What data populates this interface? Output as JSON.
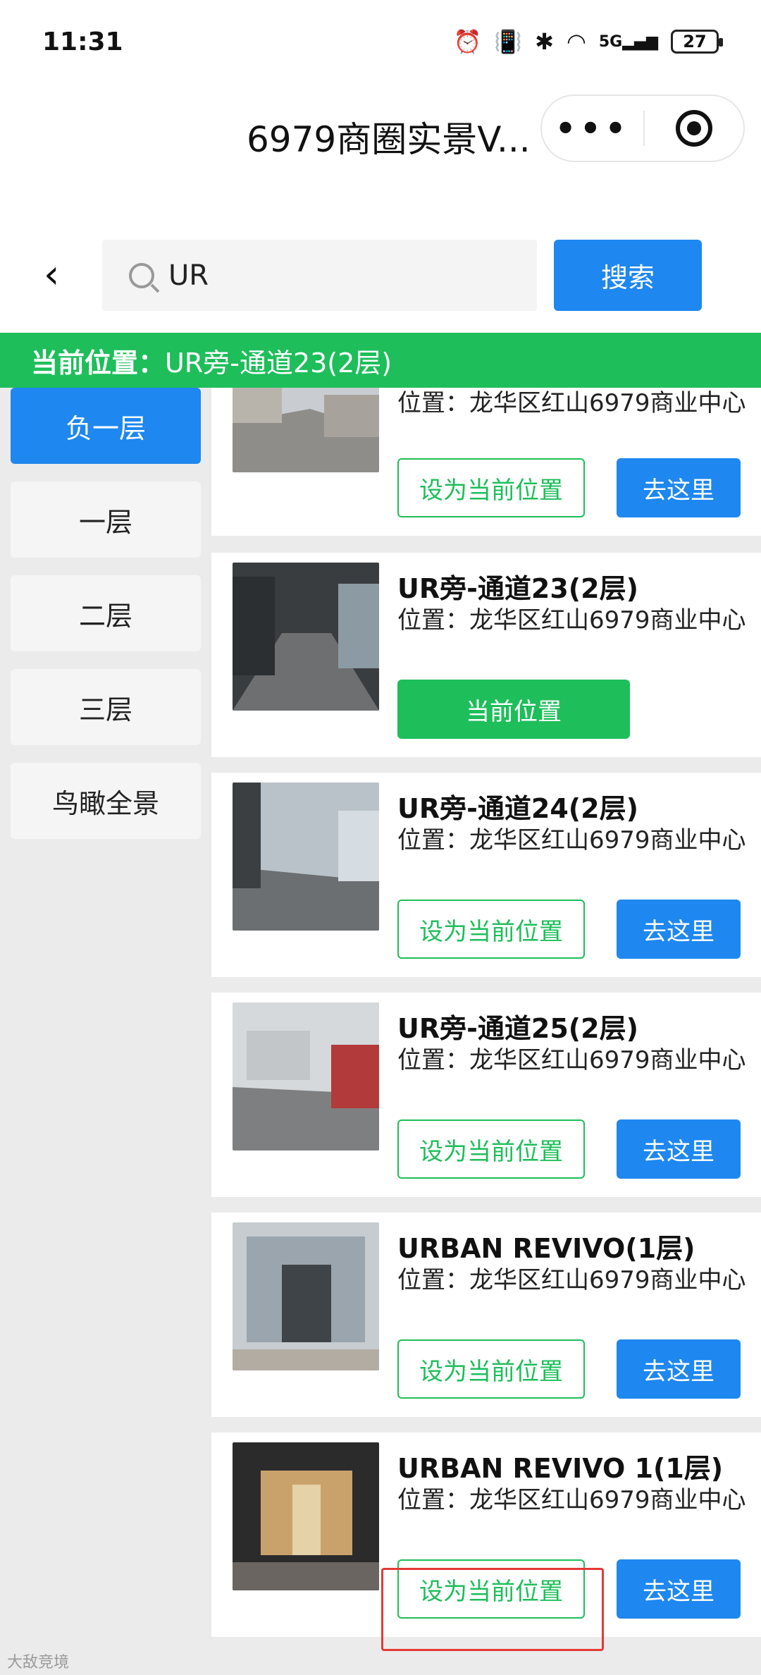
{
  "status": {
    "time": "11:31",
    "network": "5G",
    "battery": "27"
  },
  "header": {
    "title": "6979商圈实景V..."
  },
  "search": {
    "value": "UR",
    "button": "搜索"
  },
  "location": {
    "label": "当前位置：",
    "value": "UR旁-通道23(2层)"
  },
  "floors": [
    {
      "label": "负一层",
      "active": true
    },
    {
      "label": "一层"
    },
    {
      "label": "二层"
    },
    {
      "label": "三层"
    },
    {
      "label": "鸟瞰全景"
    }
  ],
  "cards": [
    {
      "title": "",
      "location": "位置：龙华区红山6979商业中心",
      "set_label": "设为当前位置",
      "go_label": "去这里"
    },
    {
      "title": "UR旁-通道23(2层)",
      "location": "位置：龙华区红山6979商业中心",
      "current_label": "当前位置"
    },
    {
      "title": "UR旁-通道24(2层)",
      "location": "位置：龙华区红山6979商业中心",
      "set_label": "设为当前位置",
      "go_label": "去这里"
    },
    {
      "title": "UR旁-通道25(2层)",
      "location": "位置：龙华区红山6979商业中心",
      "set_label": "设为当前位置",
      "go_label": "去这里"
    },
    {
      "title": "URBAN REVIVO(1层)",
      "location": "位置：龙华区红山6979商业中心",
      "set_label": "设为当前位置",
      "go_label": "去这里"
    },
    {
      "title": "URBAN REVIVO 1(1层)",
      "location": "位置：龙华区红山6979商业中心",
      "set_label": "设为当前位置",
      "go_label": "去这里"
    }
  ],
  "watermark": "大敌竞境",
  "colors": {
    "primary": "#1e87f0",
    "green": "#1ebe5a",
    "highlight": "#e53935"
  }
}
